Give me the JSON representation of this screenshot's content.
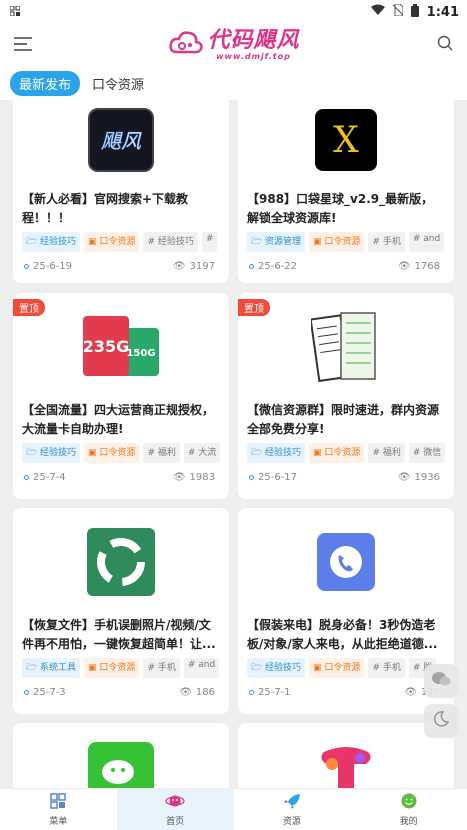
{
  "status": {
    "time": "1:41"
  },
  "header": {
    "logo_text": "代码飓风",
    "logo_url": "www.dmjf.top"
  },
  "tabs": [
    {
      "label": "最新发布"
    },
    {
      "label": "口令资源"
    }
  ],
  "pin_label": "置顶",
  "cards": [
    {
      "title": "【新人必看】官网搜索+下载教程！！！",
      "tags": [
        {
          "label": "经验技巧"
        },
        {
          "label": "口令资源"
        },
        {
          "label": "# 经验技巧"
        },
        {
          "label": "# "
        }
      ],
      "date": "25-6-19",
      "views": "3197"
    },
    {
      "title": "【988】口袋星球_v2.9_最新版，解锁全球资源库!",
      "tags": [
        {
          "label": "资源管理"
        },
        {
          "label": "口令资源"
        },
        {
          "label": "# 手机"
        },
        {
          "label": "# and"
        }
      ],
      "date": "25-6-22",
      "views": "1768"
    },
    {
      "title": "【全国流量】四大运营商正规授权，大流量卡自助办理!",
      "tags": [
        {
          "label": "经验技巧"
        },
        {
          "label": "口令资源"
        },
        {
          "label": "# 福利"
        },
        {
          "label": "# 大流"
        }
      ],
      "date": "25-7-4",
      "views": "1983"
    },
    {
      "title": "【微信资源群】限时速进，群内资源全部免费分享!",
      "tags": [
        {
          "label": "经验技巧"
        },
        {
          "label": "口令资源"
        },
        {
          "label": "# 福利"
        },
        {
          "label": "# 微信"
        }
      ],
      "date": "25-6-17",
      "views": "1936"
    },
    {
      "title": "【恢复文件】手机误删照片/视频/文件再不用怕，一键恢复超简单！让...",
      "tags": [
        {
          "label": "系统工具"
        },
        {
          "label": "口令资源"
        },
        {
          "label": "# 手机"
        },
        {
          "label": "# and"
        }
      ],
      "date": "25-7-3",
      "views": "186"
    },
    {
      "title": "【假装来电】脱身必备！3秒伪造老板/对象/家人来电，从此拒绝道德...",
      "tags": [
        {
          "label": "经验技巧"
        },
        {
          "label": "口令资源"
        },
        {
          "label": "# 手机"
        },
        {
          "label": "# 脱"
        }
      ],
      "date": "25-7-1",
      "views": "125"
    }
  ],
  "card3_img": {
    "big": "235G",
    "small": "150G"
  },
  "nav": [
    {
      "label": "菜单"
    },
    {
      "label": "首页"
    },
    {
      "label": "资源"
    },
    {
      "label": "我的"
    }
  ],
  "colors": {
    "accent": "#2aa3e8",
    "brand": "#e0348b",
    "pin": "#ee4b3c"
  }
}
